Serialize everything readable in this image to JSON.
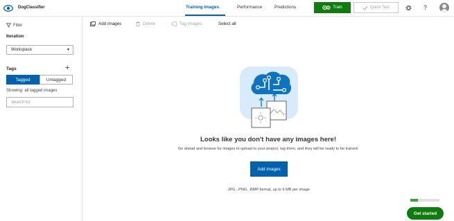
{
  "header": {
    "app_title": "DogClassifier",
    "tabs": [
      {
        "label": "Training Images",
        "active": true
      },
      {
        "label": "Performance",
        "active": false
      },
      {
        "label": "Predictions",
        "active": false
      }
    ],
    "train_label": "Train",
    "quick_test_label": "Quick Test",
    "settings_icon": "gear-icon",
    "help_label": "?",
    "accent_color": "#0062ad",
    "train_color": "#107c10"
  },
  "sidebar": {
    "filter_label": "Filter",
    "iteration_label": "Iteration",
    "iteration_value": "Workspace",
    "tags_label": "Tags",
    "add_tag_symbol": "+",
    "tagged_label": "Tagged",
    "untagged_label": "Untagged",
    "showing_text": "Showing: all tagged images",
    "search_placeholder": "Search for"
  },
  "toolbar": {
    "add_images": "Add images",
    "delete": "Delete",
    "tag_images": "Tag images",
    "select_all": "Select all"
  },
  "empty_state": {
    "title": "Looks like you don't have any images here!",
    "subtitle": "Go ahead and browse for images to upload to your project, tag them, and they will be ready to be trained.",
    "add_button": "Add images",
    "formats": ".JPG, .PNG, .BMP format, up to 6 MB per image"
  },
  "get_started": {
    "label": "Get started",
    "progress": 0.25
  }
}
